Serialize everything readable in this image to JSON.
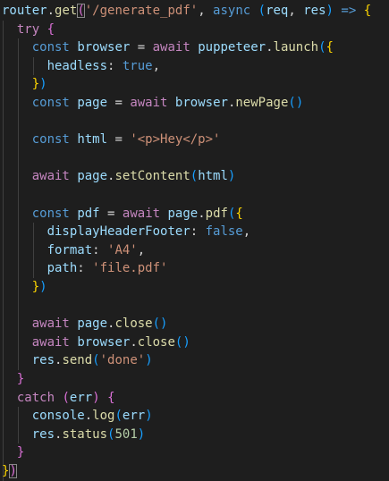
{
  "editor": {
    "lines": [
      [
        {
          "t": "router",
          "c": "var"
        },
        {
          "t": ".",
          "c": "op"
        },
        {
          "t": "get",
          "c": "fn"
        },
        {
          "t": "(",
          "c": "paren",
          "match": true
        },
        {
          "t": "'/generate_pdf'",
          "c": "str"
        },
        {
          "t": ", ",
          "c": "op"
        },
        {
          "t": "async",
          "c": "kw"
        },
        {
          "t": " ",
          "c": "op"
        },
        {
          "t": "(",
          "c": "bracket"
        },
        {
          "t": "req",
          "c": "var"
        },
        {
          "t": ", ",
          "c": "op"
        },
        {
          "t": "res",
          "c": "var"
        },
        {
          "t": ")",
          "c": "bracket"
        },
        {
          "t": " ",
          "c": "op"
        },
        {
          "t": "=>",
          "c": "kw"
        },
        {
          "t": " ",
          "c": "op"
        },
        {
          "t": "{",
          "c": "brace"
        }
      ],
      [
        {
          "t": "  ",
          "c": "op"
        },
        {
          "t": "try",
          "c": "ctl"
        },
        {
          "t": " ",
          "c": "op"
        },
        {
          "t": "{",
          "c": "paren"
        }
      ],
      [
        {
          "t": "    ",
          "c": "op"
        },
        {
          "t": "const",
          "c": "kw"
        },
        {
          "t": " ",
          "c": "op"
        },
        {
          "t": "browser",
          "c": "var"
        },
        {
          "t": " = ",
          "c": "op"
        },
        {
          "t": "await",
          "c": "ctl"
        },
        {
          "t": " ",
          "c": "op"
        },
        {
          "t": "puppeteer",
          "c": "var"
        },
        {
          "t": ".",
          "c": "op"
        },
        {
          "t": "launch",
          "c": "fn"
        },
        {
          "t": "(",
          "c": "bracket"
        },
        {
          "t": "{",
          "c": "brace"
        }
      ],
      [
        {
          "t": "      ",
          "c": "op"
        },
        {
          "t": "headless",
          "c": "var"
        },
        {
          "t": ": ",
          "c": "op"
        },
        {
          "t": "true",
          "c": "lit"
        },
        {
          "t": ",",
          "c": "op"
        }
      ],
      [
        {
          "t": "    ",
          "c": "op"
        },
        {
          "t": "}",
          "c": "brace"
        },
        {
          "t": ")",
          "c": "bracket"
        }
      ],
      [
        {
          "t": "    ",
          "c": "op"
        },
        {
          "t": "const",
          "c": "kw"
        },
        {
          "t": " ",
          "c": "op"
        },
        {
          "t": "page",
          "c": "var"
        },
        {
          "t": " = ",
          "c": "op"
        },
        {
          "t": "await",
          "c": "ctl"
        },
        {
          "t": " ",
          "c": "op"
        },
        {
          "t": "browser",
          "c": "var"
        },
        {
          "t": ".",
          "c": "op"
        },
        {
          "t": "newPage",
          "c": "fn"
        },
        {
          "t": "()",
          "c": "bracket"
        }
      ],
      [],
      [
        {
          "t": "    ",
          "c": "op"
        },
        {
          "t": "const",
          "c": "kw"
        },
        {
          "t": " ",
          "c": "op"
        },
        {
          "t": "html",
          "c": "var"
        },
        {
          "t": " = ",
          "c": "op"
        },
        {
          "t": "'<p>Hey</p>'",
          "c": "str"
        }
      ],
      [],
      [
        {
          "t": "    ",
          "c": "op"
        },
        {
          "t": "await",
          "c": "ctl"
        },
        {
          "t": " ",
          "c": "op"
        },
        {
          "t": "page",
          "c": "var"
        },
        {
          "t": ".",
          "c": "op"
        },
        {
          "t": "setContent",
          "c": "fn"
        },
        {
          "t": "(",
          "c": "bracket"
        },
        {
          "t": "html",
          "c": "var"
        },
        {
          "t": ")",
          "c": "bracket"
        }
      ],
      [],
      [
        {
          "t": "    ",
          "c": "op"
        },
        {
          "t": "const",
          "c": "kw"
        },
        {
          "t": " ",
          "c": "op"
        },
        {
          "t": "pdf",
          "c": "var"
        },
        {
          "t": " = ",
          "c": "op"
        },
        {
          "t": "await",
          "c": "ctl"
        },
        {
          "t": " ",
          "c": "op"
        },
        {
          "t": "page",
          "c": "var"
        },
        {
          "t": ".",
          "c": "op"
        },
        {
          "t": "pdf",
          "c": "fn"
        },
        {
          "t": "(",
          "c": "bracket"
        },
        {
          "t": "{",
          "c": "brace"
        }
      ],
      [
        {
          "t": "      ",
          "c": "op"
        },
        {
          "t": "displayHeaderFooter",
          "c": "var"
        },
        {
          "t": ": ",
          "c": "op"
        },
        {
          "t": "false",
          "c": "lit"
        },
        {
          "t": ",",
          "c": "op"
        }
      ],
      [
        {
          "t": "      ",
          "c": "op"
        },
        {
          "t": "format",
          "c": "var"
        },
        {
          "t": ": ",
          "c": "op"
        },
        {
          "t": "'A4'",
          "c": "str"
        },
        {
          "t": ",",
          "c": "op"
        }
      ],
      [
        {
          "t": "      ",
          "c": "op"
        },
        {
          "t": "path",
          "c": "var"
        },
        {
          "t": ": ",
          "c": "op"
        },
        {
          "t": "'file.pdf'",
          "c": "str"
        }
      ],
      [
        {
          "t": "    ",
          "c": "op"
        },
        {
          "t": "}",
          "c": "brace"
        },
        {
          "t": ")",
          "c": "bracket"
        }
      ],
      [],
      [
        {
          "t": "    ",
          "c": "op"
        },
        {
          "t": "await",
          "c": "ctl"
        },
        {
          "t": " ",
          "c": "op"
        },
        {
          "t": "page",
          "c": "var"
        },
        {
          "t": ".",
          "c": "op"
        },
        {
          "t": "close",
          "c": "fn"
        },
        {
          "t": "()",
          "c": "bracket"
        }
      ],
      [
        {
          "t": "    ",
          "c": "op"
        },
        {
          "t": "await",
          "c": "ctl"
        },
        {
          "t": " ",
          "c": "op"
        },
        {
          "t": "browser",
          "c": "var"
        },
        {
          "t": ".",
          "c": "op"
        },
        {
          "t": "close",
          "c": "fn"
        },
        {
          "t": "()",
          "c": "bracket"
        }
      ],
      [
        {
          "t": "    ",
          "c": "op"
        },
        {
          "t": "res",
          "c": "var"
        },
        {
          "t": ".",
          "c": "op"
        },
        {
          "t": "send",
          "c": "fn"
        },
        {
          "t": "(",
          "c": "bracket"
        },
        {
          "t": "'done'",
          "c": "str"
        },
        {
          "t": ")",
          "c": "bracket"
        }
      ],
      [
        {
          "t": "  ",
          "c": "op"
        },
        {
          "t": "}",
          "c": "paren"
        }
      ],
      [
        {
          "t": "  ",
          "c": "op"
        },
        {
          "t": "catch",
          "c": "ctl"
        },
        {
          "t": " ",
          "c": "op"
        },
        {
          "t": "(",
          "c": "paren"
        },
        {
          "t": "err",
          "c": "var"
        },
        {
          "t": ")",
          "c": "paren"
        },
        {
          "t": " ",
          "c": "op"
        },
        {
          "t": "{",
          "c": "paren"
        }
      ],
      [
        {
          "t": "    ",
          "c": "op"
        },
        {
          "t": "console",
          "c": "var"
        },
        {
          "t": ".",
          "c": "op"
        },
        {
          "t": "log",
          "c": "fn"
        },
        {
          "t": "(",
          "c": "bracket"
        },
        {
          "t": "err",
          "c": "var"
        },
        {
          "t": ")",
          "c": "bracket"
        }
      ],
      [
        {
          "t": "    ",
          "c": "op"
        },
        {
          "t": "res",
          "c": "var"
        },
        {
          "t": ".",
          "c": "op"
        },
        {
          "t": "status",
          "c": "fn"
        },
        {
          "t": "(",
          "c": "bracket"
        },
        {
          "t": "501",
          "c": "num"
        },
        {
          "t": ")",
          "c": "bracket"
        }
      ],
      [
        {
          "t": "  ",
          "c": "op"
        },
        {
          "t": "}",
          "c": "paren"
        }
      ],
      [
        {
          "t": "}",
          "c": "brace"
        },
        {
          "t": ")",
          "c": "paren",
          "match": true
        }
      ]
    ]
  },
  "colors": {
    "background": "#1e1e1e",
    "keyword": "#569cd6",
    "control": "#c586c0",
    "variable": "#9cdcfe",
    "function": "#dcdcaa",
    "string": "#ce9178",
    "number": "#b5cea8",
    "bracket_gold": "#ffd700",
    "bracket_orchid": "#da70d6",
    "bracket_blue": "#179fff"
  }
}
